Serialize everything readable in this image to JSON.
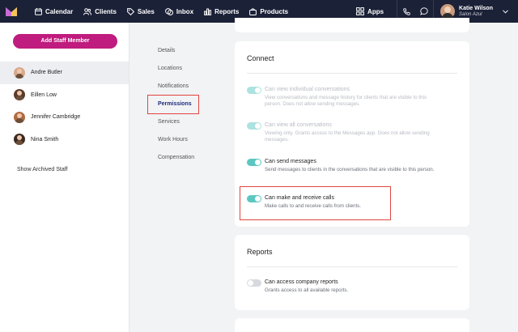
{
  "topnav": {
    "items": [
      {
        "label": "Calendar",
        "icon": "calendar-icon"
      },
      {
        "label": "Clients",
        "icon": "clients-icon"
      },
      {
        "label": "Sales",
        "icon": "sales-tag-icon"
      },
      {
        "label": "Inbox",
        "icon": "inbox-chat-icon"
      },
      {
        "label": "Reports",
        "icon": "reports-chart-icon"
      },
      {
        "label": "Products",
        "icon": "products-bag-icon"
      }
    ],
    "apps_label": "Apps",
    "user_name": "Katie Wilson",
    "user_subtitle": "Salon Azul",
    "colors": {
      "nav_bg": "#1b2137",
      "accent_pink": "#c01b7e",
      "toggle_on": "#5cc7c2",
      "highlight": "#e0463e"
    }
  },
  "left": {
    "add_button": "Add Staff Member",
    "staff": [
      {
        "name": "Andre Butler",
        "active": true
      },
      {
        "name": "Eillen Low",
        "active": false
      },
      {
        "name": "Jennifer Cambridge",
        "active": false
      },
      {
        "name": "Nina Smith",
        "active": false
      }
    ],
    "show_archived": "Show Archived Staff"
  },
  "subnav": {
    "items": [
      {
        "label": "Details",
        "active": false
      },
      {
        "label": "Locations",
        "active": false
      },
      {
        "label": "Notifications",
        "active": false
      },
      {
        "label": "Permissions",
        "active": true
      },
      {
        "label": "Services",
        "active": false
      },
      {
        "label": "Work Hours",
        "active": false
      },
      {
        "label": "Compensation",
        "active": false
      }
    ]
  },
  "connect": {
    "title": "Connect",
    "perms": [
      {
        "title": "Can view individual conversations",
        "desc": "View conversations and message history for clients that are visible to this person. Does not allow sending messages.",
        "on": true,
        "disabled": true
      },
      {
        "title": "Can view all conversations",
        "desc": "Viewing only. Grants access to the Messages app. Does not allow sending messages.",
        "on": true,
        "disabled": true
      },
      {
        "title": "Can send messages",
        "desc": "Send messages to clients in the conversations that are visible to this person.",
        "on": true,
        "disabled": false
      },
      {
        "title": "Can make and receive calls",
        "desc": "Make calls to and receive calls from clients.",
        "on": true,
        "disabled": false
      }
    ]
  },
  "reports": {
    "title": "Reports",
    "perms": [
      {
        "title": "Can access company reports",
        "desc": "Grants access to all available reports.",
        "on": false,
        "disabled": false
      }
    ]
  }
}
